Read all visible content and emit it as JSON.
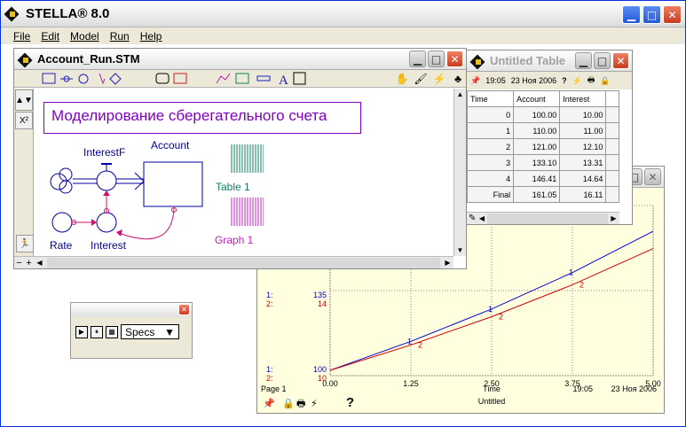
{
  "app": {
    "title": "STELLA® 8.0",
    "window_buttons": [
      "minimize",
      "maximize",
      "close"
    ]
  },
  "menubar": {
    "items": [
      {
        "label": "File"
      },
      {
        "label": "Edit"
      },
      {
        "label": "Model"
      },
      {
        "label": "Run"
      },
      {
        "label": "Help"
      }
    ]
  },
  "model_window": {
    "title": "Account_Run.STM",
    "model_heading": "Моделирование сберегательного счета",
    "labels": {
      "interestf": "InterestF",
      "account": "Account",
      "rate": "Rate",
      "interest": "Interest",
      "table": "Table 1",
      "graph": "Graph 1"
    },
    "strip": {
      "x2": "X²",
      "minus": "−",
      "plus": "+"
    }
  },
  "table_window": {
    "title": "Untitled Table",
    "time": "19:05",
    "date": "23 Ноя 2006",
    "headers": [
      "Time",
      "Account",
      "Interest"
    ],
    "rows": [
      [
        "0",
        "100.00",
        "10.00"
      ],
      [
        "1",
        "110.00",
        "11.00"
      ],
      [
        "2",
        "121.00",
        "12.10"
      ],
      [
        "3",
        "133.10",
        "13.31"
      ],
      [
        "4",
        "146.41",
        "14.64"
      ],
      [
        "Final",
        "161.05",
        "16.11"
      ]
    ]
  },
  "graph_window": {
    "page": "Page 1",
    "title": "Untitled",
    "time": "19:05",
    "date": "23 Ноя 2006",
    "xlabel": "Time",
    "y_top_series1_label": "1:",
    "y_top_series1_value": "135",
    "y_top_series2_label": "2:",
    "y_top_series2_value": "14",
    "y_bot_series1_label": "1:",
    "y_bot_series1_value": "100",
    "y_bot_series2_label": "2:",
    "y_bot_series2_value": "10",
    "help_glyph": "?"
  },
  "chart_data": {
    "type": "line",
    "x_ticks": [
      "0.00",
      "1.25",
      "2.50",
      "3.75",
      "5.00"
    ],
    "xlim": [
      0,
      5
    ],
    "xlabel": "Time",
    "series": [
      {
        "name": "1",
        "color": "#0000cc",
        "x": [
          0,
          1.25,
          2.5,
          3.75,
          5
        ],
        "y": [
          100,
          112.7,
          126.9,
          142.9,
          161.05
        ],
        "ylim": [
          100,
          135
        ]
      },
      {
        "name": "2",
        "color": "#cc0000",
        "x": [
          0,
          1.25,
          2.5,
          3.75,
          5
        ],
        "y": [
          10,
          11.27,
          12.69,
          14.29,
          16.11
        ],
        "ylim": [
          10,
          14
        ]
      }
    ],
    "grid": true
  },
  "specs_window": {
    "dropdown_value": "Specs"
  },
  "colors": {
    "model_heading": "#8000c0",
    "stock_flow": "#0000a0",
    "connector": "#d01070",
    "graph_bg": "#ffffe0"
  }
}
